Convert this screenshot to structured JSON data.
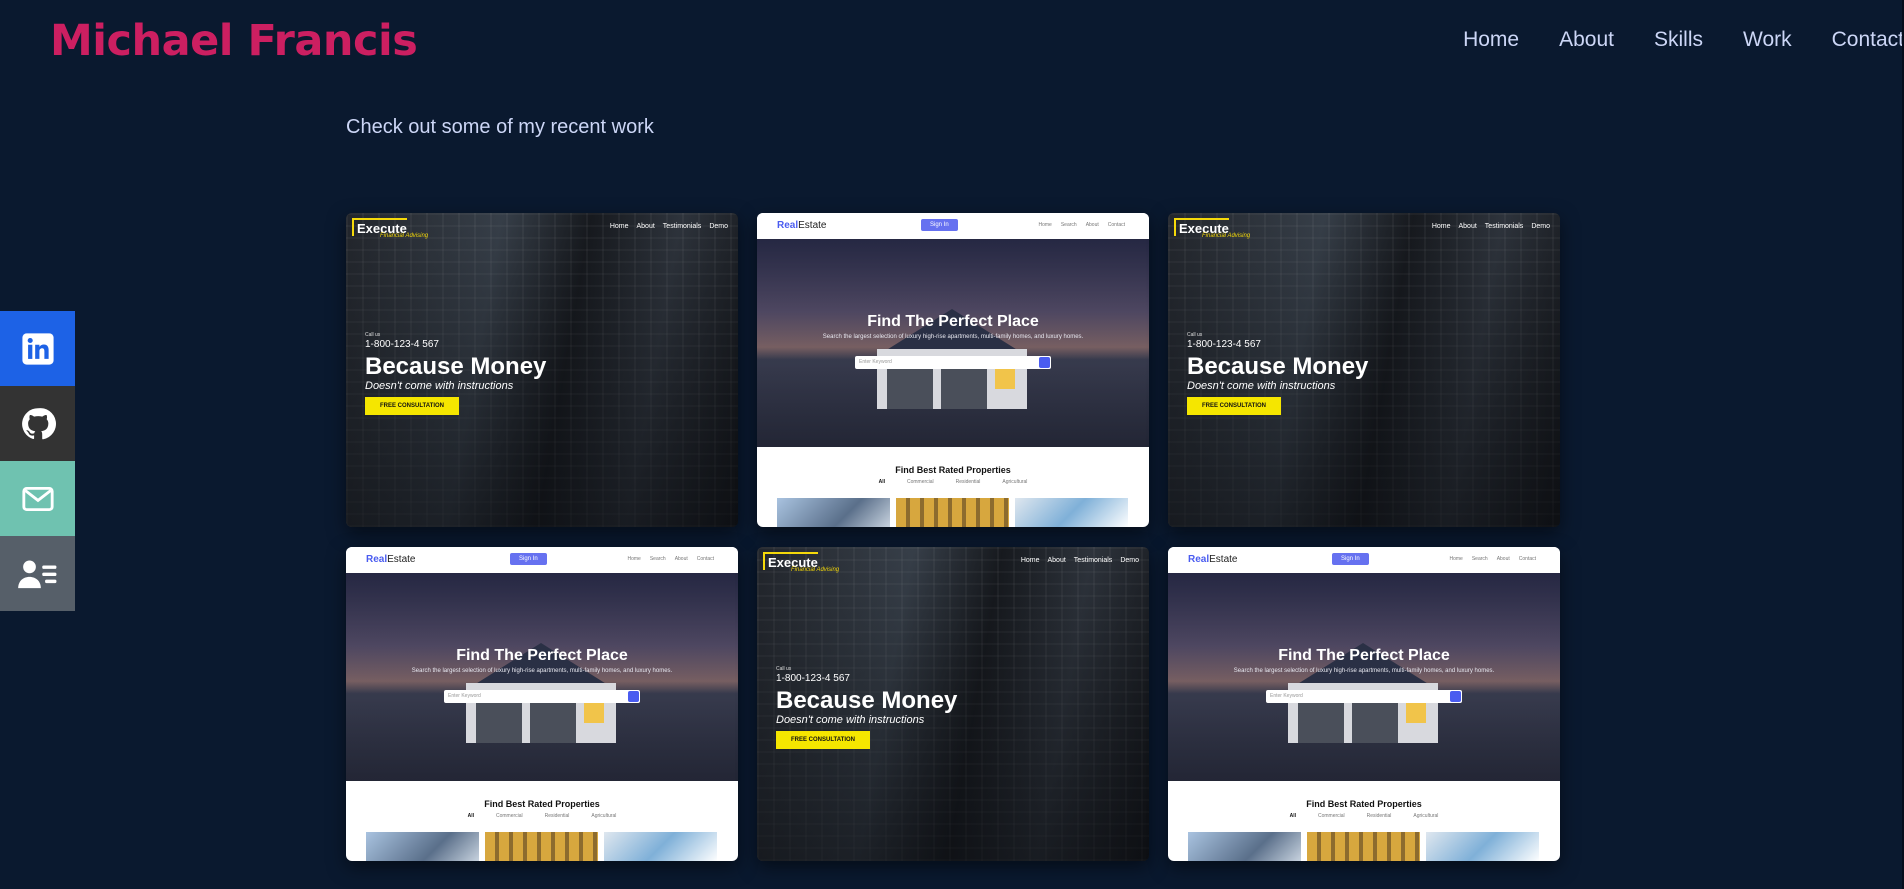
{
  "header": {
    "brand": "Michael Francis",
    "nav": [
      "Home",
      "About",
      "Skills",
      "Work",
      "Contact"
    ]
  },
  "intro": "Check out some of my recent work",
  "social": [
    {
      "name": "linkedin-icon",
      "color": "#1d62e6"
    },
    {
      "name": "github-icon",
      "color": "#333333"
    },
    {
      "name": "mail-icon",
      "color": "#6fc2b0"
    },
    {
      "name": "resume-icon",
      "color": "#565f69"
    }
  ],
  "colors": {
    "background": "#0a192f",
    "brand": "#cc1f61",
    "text": "#ccd6f6",
    "accent_yellow": "#f5e600"
  },
  "execute": {
    "logo": "Execute",
    "logo_sub": "Financial Advising",
    "nav": [
      "Home",
      "About",
      "Testimonials",
      "Demo"
    ],
    "call_label": "Call us",
    "phone": "1-800-123-4 567",
    "headline": "Because Money",
    "tagline": "Doesn't come with instructions",
    "cta": "FREE CONSULTATION"
  },
  "realestate": {
    "logo_prefix": "Real",
    "logo_suffix": "Estate",
    "signin": "Sign In",
    "nav": [
      "Home",
      "Search",
      "About",
      "Contact"
    ],
    "hero_title": "Find The Perfect Place",
    "hero_sub": "Search the largest selection of luxury high-rise apartments, multi-family homes, and luxury homes.",
    "search_placeholder": "Enter Keyword",
    "section_title": "Find Best Rated Properties",
    "tabs": [
      "All",
      "Commercial",
      "Residential",
      "Agricultural"
    ]
  }
}
